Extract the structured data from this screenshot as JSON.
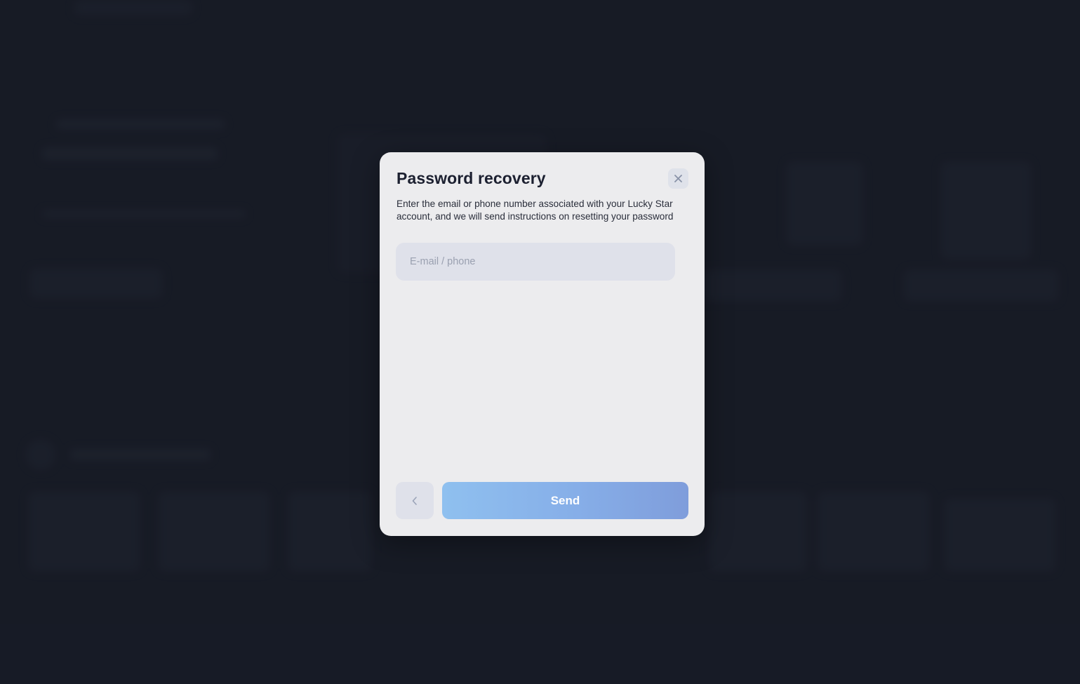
{
  "modal": {
    "title": "Password recovery",
    "description": "Enter the email or phone number associated with your Lucky Star account, and we will send instructions on resetting your password",
    "input": {
      "value": "",
      "placeholder": "E-mail / phone"
    },
    "send_label": "Send",
    "icons": {
      "close": "close-icon",
      "back": "chevron-left-icon"
    }
  },
  "colors": {
    "background": "#1b1f2b",
    "modal": "#ececee",
    "send_gradient_start": "#8fc0ef",
    "send_gradient_end": "#7f9ddb"
  }
}
